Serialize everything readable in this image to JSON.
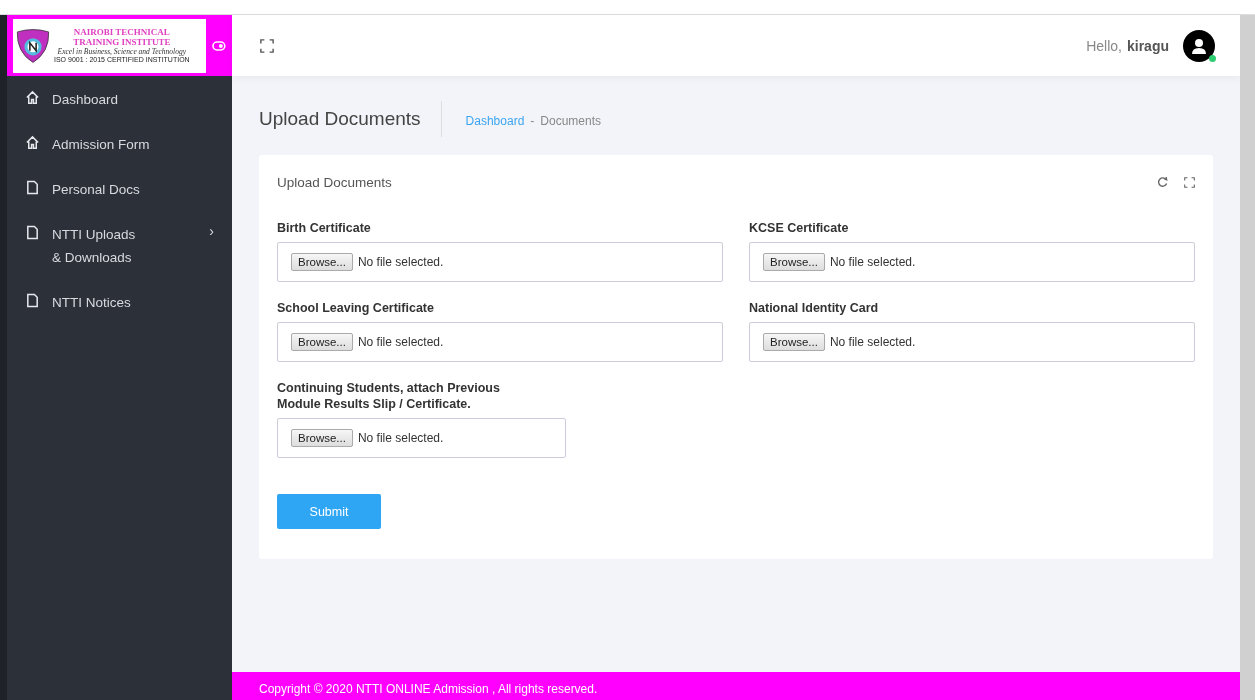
{
  "logo": {
    "title_lines": [
      "NAIROBI TECHNICAL",
      "TRAINING INSTITUTE"
    ],
    "motto": "Excel in Business, Science and Technology",
    "certification": "ISO 9001 : 2015 CERTIFIED INSTITUTION"
  },
  "sidebar": {
    "items": [
      {
        "label": "Dashboard",
        "kind": "home",
        "expandable": false
      },
      {
        "label": "Admission Form",
        "kind": "home",
        "expandable": false
      },
      {
        "label": "Personal Docs",
        "kind": "document",
        "expandable": false
      },
      {
        "label": "NTTI Uploads & Downloads",
        "kind": "document",
        "expandable": true,
        "chevron": "›"
      },
      {
        "label": "NTTI Notices",
        "kind": "document",
        "expandable": false
      }
    ]
  },
  "header": {
    "greeting": "Hello,",
    "username": "kiragu",
    "online": true
  },
  "page": {
    "title": "Upload Documents",
    "breadcrumb": [
      {
        "label": "Dashboard",
        "link": true
      },
      {
        "label": "-",
        "link": false
      },
      {
        "label": "Documents",
        "link": false
      }
    ]
  },
  "card": {
    "title": "Upload Documents",
    "fields": [
      {
        "label": "Birth Certificate",
        "button": "Browse...",
        "status": "No file selected.",
        "wide": true
      },
      {
        "label": "KCSE Certificate",
        "button": "Browse...",
        "status": "No file selected.",
        "wide": true
      },
      {
        "label": "School Leaving Certificate",
        "button": "Browse...",
        "status": "No file selected.",
        "wide": true
      },
      {
        "label": "National Identity Card",
        "button": "Browse...",
        "status": "No file selected.",
        "wide": true
      },
      {
        "label": "Continuing Students, attach Previous Module Results Slip / Certificate.",
        "button": "Browse...",
        "status": "No file selected.",
        "wide": false
      }
    ],
    "submit": "Submit"
  },
  "footer": {
    "text": "Copyright © 2020 NTTI ONLINE Admission , All rights reserved."
  }
}
